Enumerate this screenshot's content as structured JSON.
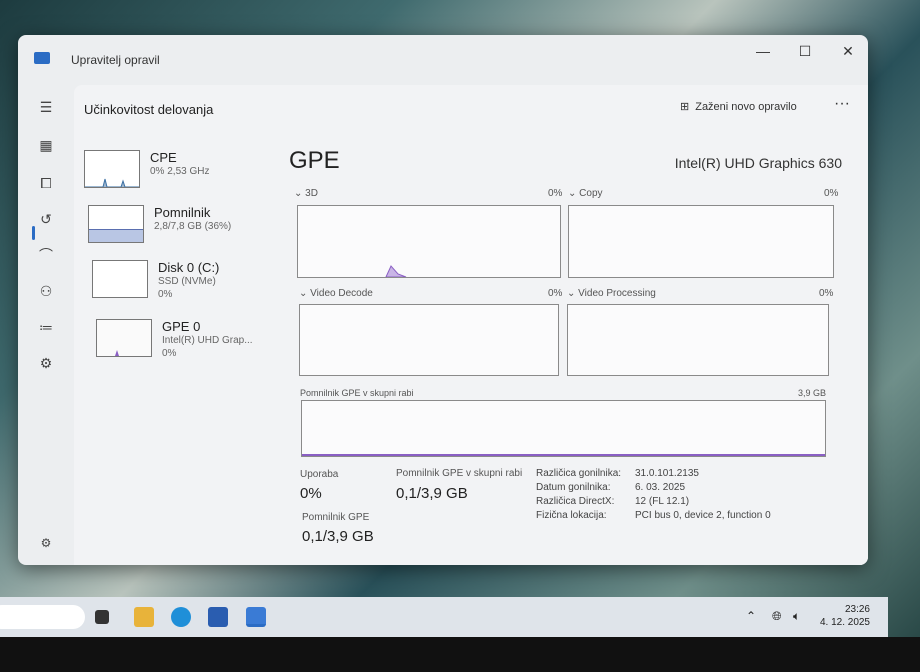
{
  "window": {
    "title": "Upravitelj opravil",
    "minimize": "—",
    "maximize": "☐",
    "close": "✕"
  },
  "header": {
    "title": "Učinkovitost delovanja",
    "new_task": "Zaženi novo opravilo",
    "more": "···"
  },
  "sidebar": [
    {
      "name": "CPE",
      "line1": "0% 2,53 GHz",
      "line2": ""
    },
    {
      "name": "Pomnilnik",
      "line1": "2,8/7,8 GB (36%)",
      "line2": ""
    },
    {
      "name": "Disk 0 (C:)",
      "line1": "SSD (NVMe)",
      "line2": "0%"
    },
    {
      "name": "GPE 0",
      "line1": "Intel(R) UHD Grap...",
      "line2": "0%"
    }
  ],
  "gpu": {
    "title": "GPE",
    "name": "Intel(R) UHD Graphics 630",
    "engines": [
      {
        "label": "3D",
        "value": "0%"
      },
      {
        "label": "Copy",
        "value": "0%"
      },
      {
        "label": "Video Decode",
        "value": "0%"
      },
      {
        "label": "Video Processing",
        "value": "0%"
      }
    ],
    "shared_label": "Pomnilnik GPE v skupni rabi",
    "shared_max": "3,9 GB",
    "usage_label": "Uporaba",
    "usage": "0%",
    "shared_stat_label": "Pomnilnik GPE v skupni rabi",
    "shared_stat": "0,1/3,9 GB",
    "mem_label": "Pomnilnik GPE",
    "mem": "0,1/3,9 GB",
    "details": [
      {
        "k": "Različica gonilnika:",
        "v": "31.0.101.2135"
      },
      {
        "k": "Datum gonilnika:",
        "v": "6. 03. 2025"
      },
      {
        "k": "Različica DirectX:",
        "v": "12 (FL 12.1)"
      },
      {
        "k": "Fizična lokacija:",
        "v": "PCI bus 0, device 2, function 0"
      }
    ]
  },
  "taskbar": {
    "time": "23:26",
    "date": "4. 12. 2025"
  }
}
